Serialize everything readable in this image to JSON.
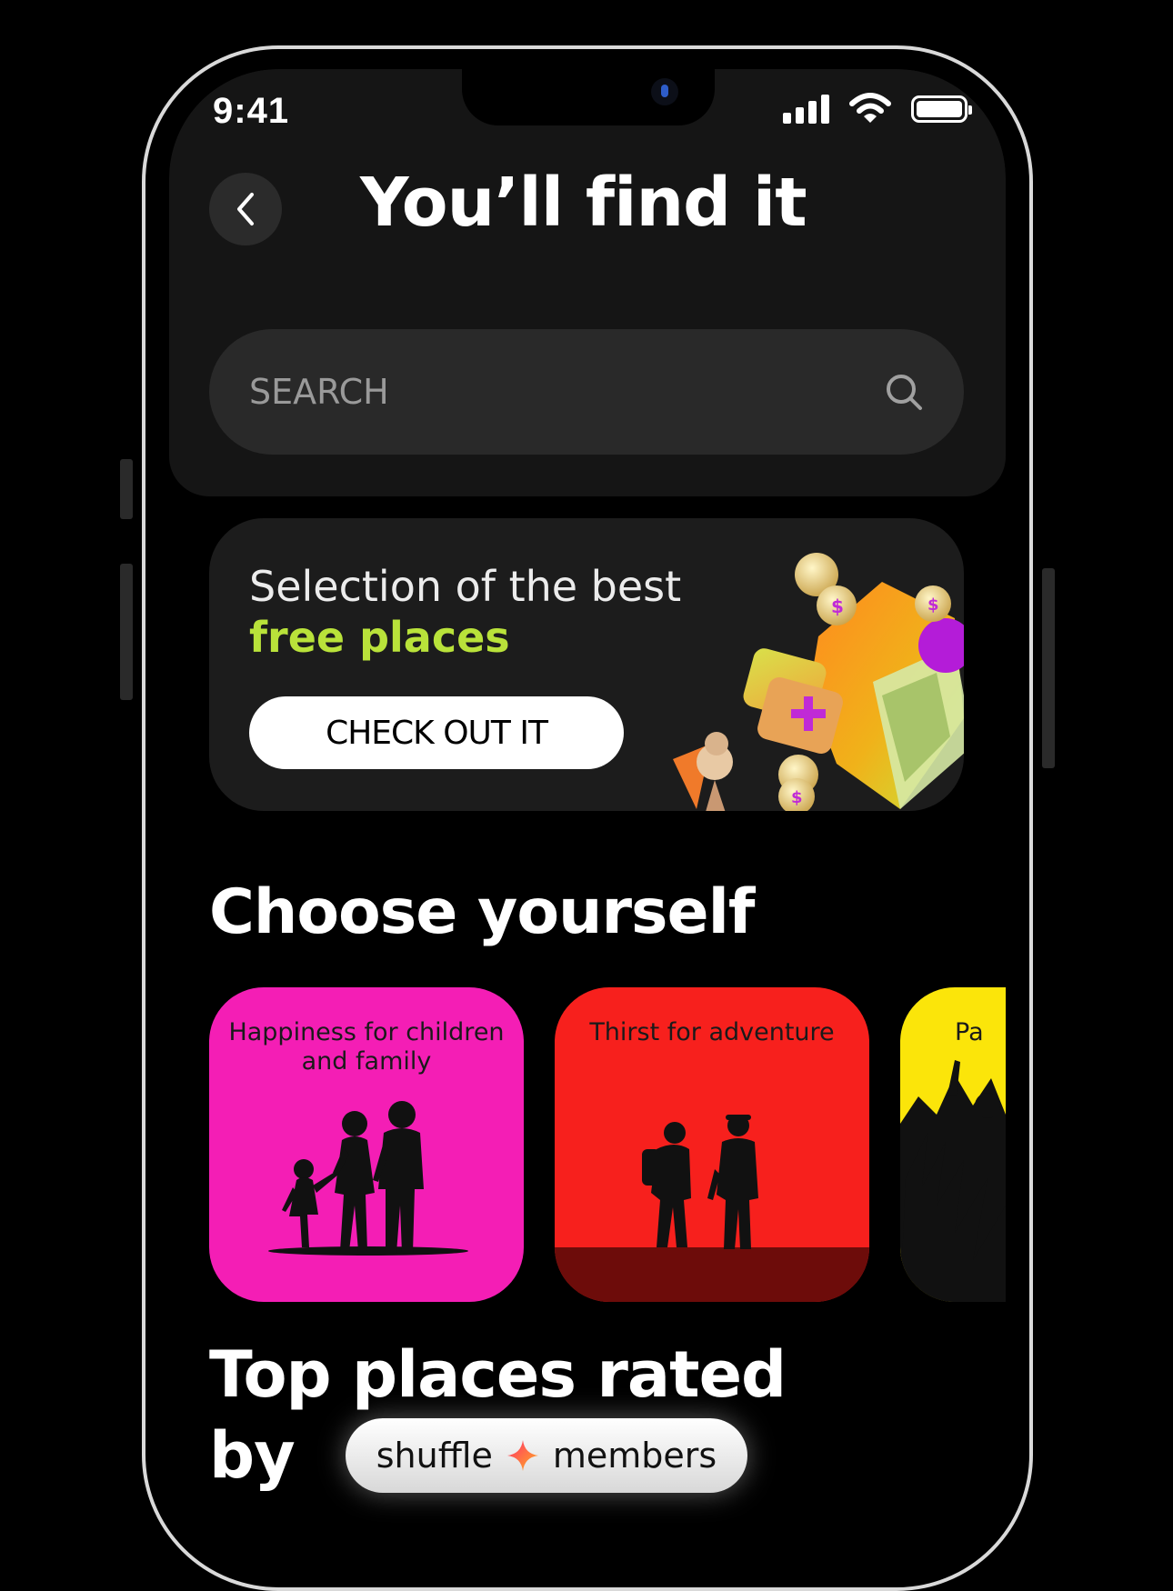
{
  "status_bar": {
    "time": "9:41",
    "icons": [
      "cellular-signal-icon",
      "wifi-icon",
      "battery-icon"
    ]
  },
  "header": {
    "back_icon": "chevron-left-icon",
    "title": "You’ll find it"
  },
  "search": {
    "placeholder": "SEARCH",
    "icon": "search-icon"
  },
  "promo": {
    "line1": "Selection of the best",
    "line2": "free places",
    "button_label": "CHECK OUT IT",
    "colors": {
      "highlight": "#b9e23a"
    }
  },
  "categories": {
    "heading": "Choose yourself",
    "items": [
      {
        "label": "Happiness for children and family",
        "color": "#f41eb5"
      },
      {
        "label": "Thirst for adventure",
        "color": "#f7201d"
      },
      {
        "label": "Pa",
        "color": "#fbe50a"
      }
    ]
  },
  "top_places": {
    "heading_line1": "Top places rated",
    "heading_by": "by",
    "badge_left": "shuffle",
    "badge_right": "members",
    "badge_icon": "four-point-star-icon"
  }
}
